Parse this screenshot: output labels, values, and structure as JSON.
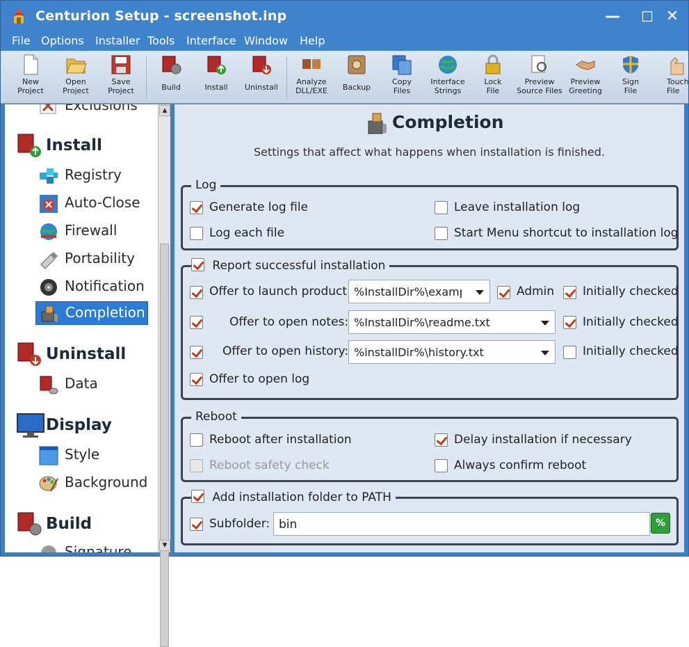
{
  "window": {
    "title": "Centurion Setup - screenshot.inp"
  },
  "menu": [
    {
      "label": "File"
    },
    {
      "label": "Options"
    },
    {
      "label": "Installer"
    },
    {
      "label": "Tools"
    },
    {
      "label": "Interface"
    },
    {
      "label": "Window"
    },
    {
      "label": "Help"
    }
  ],
  "toolbar": [
    {
      "label": "New\nProject",
      "icon": "new-project-icon"
    },
    {
      "label": "Open\nProject",
      "icon": "open-project-icon"
    },
    {
      "label": "Save\nProject",
      "icon": "save-project-icon"
    },
    {
      "label": "Build",
      "icon": "build-icon"
    },
    {
      "label": "Install",
      "icon": "install-icon"
    },
    {
      "label": "Uninstall",
      "icon": "uninstall-icon"
    },
    {
      "label": "Analyze\nDLL/EXE",
      "icon": "analyze-icon"
    },
    {
      "label": "Backup",
      "icon": "backup-icon"
    },
    {
      "label": "Copy\nFiles",
      "icon": "copy-files-icon"
    },
    {
      "label": "Interface\nStrings",
      "icon": "interface-strings-icon"
    },
    {
      "label": "Lock\nFile",
      "icon": "lock-icon"
    },
    {
      "label": "Preview\nSource Files",
      "icon": "preview-source-icon"
    },
    {
      "label": "Preview\nGreeting",
      "icon": "preview-greeting-icon"
    },
    {
      "label": "Sign\nFile",
      "icon": "sign-file-icon"
    },
    {
      "label": "Touch\nFile",
      "icon": "touch-file-icon"
    }
  ],
  "sidebar": {
    "partial_top": "Exclusions",
    "groups": [
      {
        "label": "Install",
        "items": [
          "Registry",
          "Auto-Close",
          "Firewall",
          "Portability",
          "Notification",
          "Completion"
        ]
      },
      {
        "label": "Uninstall",
        "items": [
          "Data"
        ]
      },
      {
        "label": "Display",
        "items": [
          "Style",
          "Background"
        ]
      },
      {
        "label": "Build",
        "items": [
          "Signature"
        ]
      }
    ],
    "selected": "Completion"
  },
  "page": {
    "title": "Completion",
    "subtitle": "Settings that affect what happens when installation is finished.",
    "log": {
      "legend": "Log",
      "generate": {
        "label": "Generate log file",
        "checked": true
      },
      "leave": {
        "label": "Leave installation log",
        "checked": false
      },
      "each": {
        "label": "Log each file",
        "checked": false
      },
      "shortcut": {
        "label": "Start Menu shortcut to installation log",
        "checked": false
      }
    },
    "report": {
      "legend": "Report successful installation",
      "launch": {
        "label": "Offer to launch product:",
        "value": "%InstallDir%\\example",
        "admin": "Admin",
        "initially": "Initially checked"
      },
      "notes": {
        "label": "Offer to open notes:",
        "value": "%InstallDir%\\readme.txt",
        "initially": "Initially checked"
      },
      "history": {
        "label": "Offer to open history:",
        "value": "%installDir%\\history.txt",
        "initially": "Initially checked"
      },
      "openlog": {
        "label": "Offer to open log"
      }
    },
    "reboot": {
      "legend": "Reboot",
      "after": {
        "label": "Reboot after installation",
        "checked": false
      },
      "delay": {
        "label": "Delay installation if necessary",
        "checked": true
      },
      "safety": {
        "label": "Reboot safety check",
        "checked": false
      },
      "confirm": {
        "label": "Always confirm reboot",
        "checked": false
      }
    },
    "path": {
      "legend": "Add installation folder to PATH",
      "subfolder_label": "Subfolder:",
      "subfolder_value": "bin",
      "percent_button": "%"
    }
  },
  "colors": {
    "titlebar": "#3f83cc",
    "selection": "#2e7bd6",
    "check": "#c23a1a"
  }
}
